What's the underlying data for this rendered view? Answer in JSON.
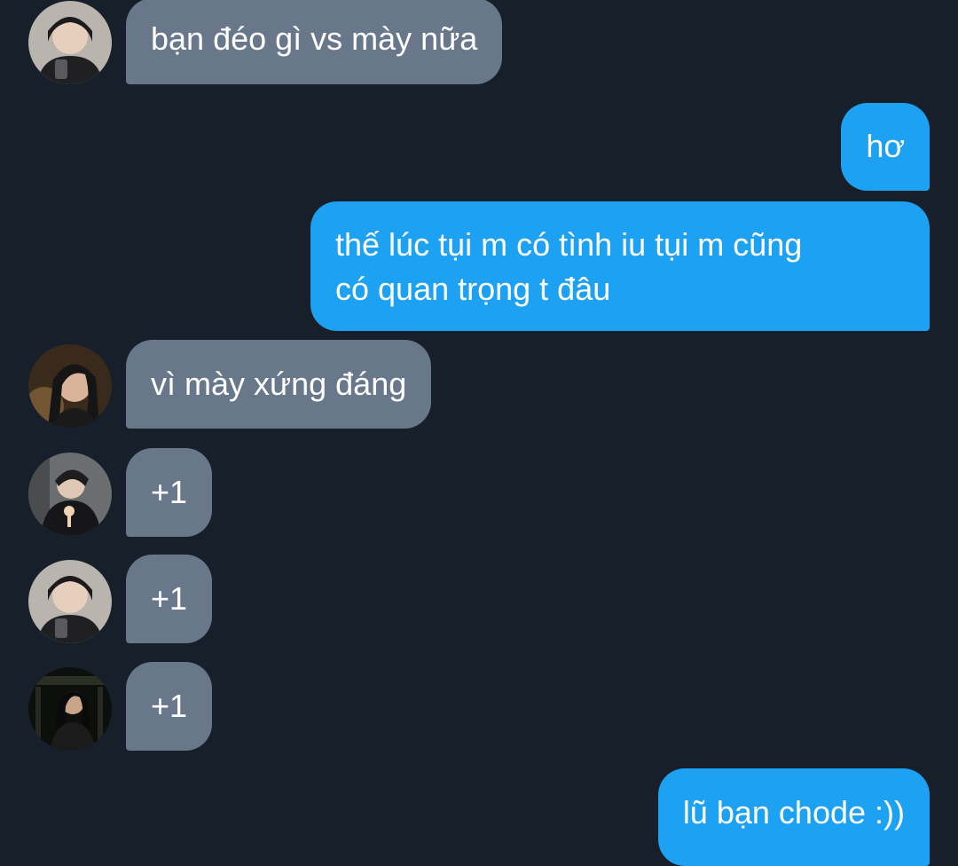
{
  "colors": {
    "background": "#17202a",
    "incoming_bubble": "#68778a",
    "outgoing_bubble": "#1da1f2",
    "text": "#ffffff"
  },
  "messages": [
    {
      "direction": "incoming",
      "avatar": "avatar-photo-1",
      "text": "bạn đéo gì vs mày nữa"
    },
    {
      "direction": "outgoing",
      "text": "hơ"
    },
    {
      "direction": "outgoing",
      "lines": [
        "thế lúc tụi m có tình iu tụi m cũng",
        "có quan trọng t đâu"
      ]
    },
    {
      "direction": "incoming",
      "avatar": "avatar-photo-2",
      "text": "vì mày xứng đáng"
    },
    {
      "direction": "incoming",
      "avatar": "avatar-photo-3",
      "text": "+1"
    },
    {
      "direction": "incoming",
      "avatar": "avatar-photo-1",
      "text": "+1"
    },
    {
      "direction": "incoming",
      "avatar": "avatar-photo-4",
      "text": "+1"
    },
    {
      "direction": "outgoing",
      "text": "lũ bạn chode :))"
    }
  ]
}
